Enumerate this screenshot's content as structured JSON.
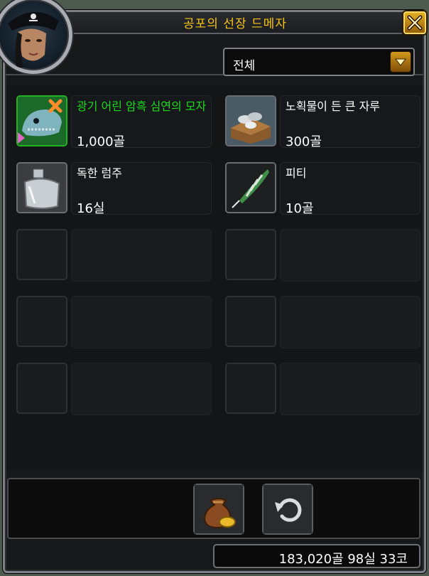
{
  "window": {
    "title": "공포의 선장 드메자"
  },
  "filter": {
    "selected": "전체"
  },
  "items": [
    {
      "name": "광기 어린 암흑 심연의 모자",
      "price": "1,000골",
      "quality": "uncommon"
    },
    {
      "name": "노획물이 든 큰 자루",
      "price": "300골",
      "quality": "common"
    },
    {
      "name": "독한 럼주",
      "price": "16실",
      "quality": "common"
    },
    {
      "name": "피티",
      "price": "10골",
      "quality": "common"
    }
  ],
  "money": {
    "display": "183,020골 98실 33코"
  },
  "colors": {
    "title": "#f6c316",
    "uncommon": "#1bdc1b",
    "common": "#ffffff"
  },
  "icons": {
    "close": "close-icon",
    "dropdown": "chevron-down-icon",
    "sell": "coin-bag-icon",
    "buyback": "undo-icon"
  }
}
